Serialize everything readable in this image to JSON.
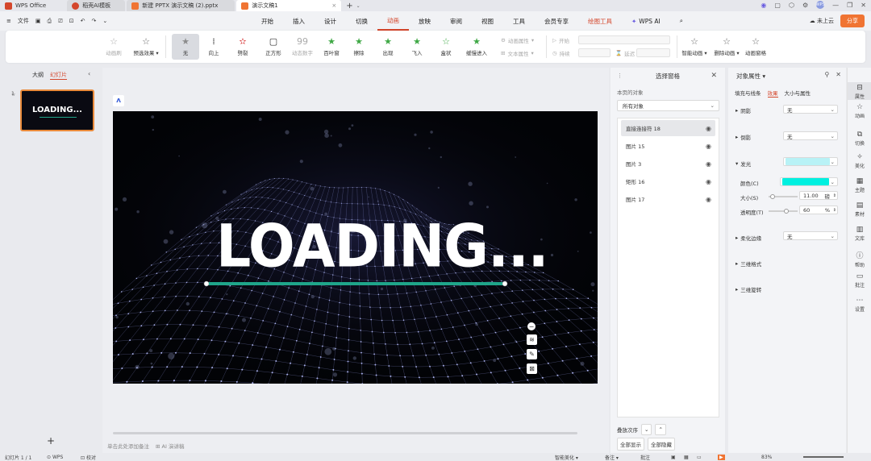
{
  "titlebar": {
    "tabs": [
      {
        "label": "WPS Office",
        "color": "#d4462b"
      },
      {
        "label": "稻壳AI模板",
        "color": "#d4462b"
      },
      {
        "label": "新建 PPTX 演示文稿 (2).pptx",
        "color": "#f07433"
      },
      {
        "label": "演示文稿1",
        "color": "#f07433"
      }
    ],
    "add": "+",
    "avatar_text": "WPS"
  },
  "menubar": {
    "file_label": "文件",
    "tabs": [
      "开始",
      "插入",
      "设计",
      "切换",
      "动画",
      "放映",
      "审阅",
      "视图",
      "工具",
      "会员专享",
      "绘图工具",
      "WPS AI"
    ],
    "active_tab": "动画",
    "cloud_label": "未上云",
    "share_label": "分享"
  },
  "ribbon": {
    "animation_pane": "动画刷",
    "preset_effects": "预选效果",
    "effects": [
      "无",
      "向上",
      "劈裂",
      "正方形",
      "动态数字",
      "百叶窗",
      "擦除",
      "出现",
      "飞入",
      "盒状",
      "缓慢进入"
    ],
    "anim_props": "动画属性",
    "text_props": "文本属性",
    "start_label": "开始",
    "duration_label": "持续",
    "delay_label": "延迟",
    "smart_anim": "智能动画",
    "delete_anim": "删除动画",
    "anim_window": "动画窗格"
  },
  "left_panel": {
    "tabs": [
      "大纲",
      "幻灯片"
    ],
    "active_tab": "幻灯片",
    "slide_number": "1",
    "thumb_text": "LOADING..."
  },
  "slide": {
    "title_text": "LOADING...",
    "progress_color": "#1fa58a",
    "progress_fill": 1.0
  },
  "canvas": {
    "notes_placeholder": "单击此处添加备注",
    "ai_notes": "AI 演讲稿"
  },
  "selection_pane": {
    "title": "选择窗格",
    "subtitle": "本页的对象",
    "filter": "所有对象",
    "items": [
      "直接连接符 18",
      "图片 15",
      "图片 3",
      "矩形 16",
      "图片 17"
    ],
    "order_label": "叠放次序",
    "show_all": "全部显示",
    "hide_all": "全部隐藏"
  },
  "properties_pane": {
    "title": "对象属性",
    "tabs": [
      "填充与线条",
      "效果",
      "大小与属性"
    ],
    "active_tab": "效果",
    "shadow": {
      "label": "阴影",
      "value": "无"
    },
    "reflection": {
      "label": "倒影",
      "value": "无"
    },
    "glow": {
      "label": "发光",
      "color_label": "颜色(C)",
      "color": "#00f0e0",
      "preset_color": "#b8f2f6",
      "size_label": "大小(S)",
      "size_value": "11.00",
      "size_unit": "磅",
      "transparency_label": "透明度(T)",
      "transparency_value": "60",
      "transparency_unit": "%"
    },
    "soft_edges": {
      "label": "柔化边缘",
      "value": "无"
    },
    "format_3d": "三维格式",
    "rotation_3d": "三维旋转"
  },
  "right_strip": [
    "属性",
    "动画",
    "切换",
    "美化",
    "主题",
    "素材",
    "文库",
    "帮助",
    "批注",
    "设置"
  ],
  "statusbar": {
    "slide_count": "幻灯片 1 / 1",
    "theme": "WPS",
    "proof": "校对",
    "smart_beautify": "智能美化",
    "notes": "备注",
    "comments": "批注",
    "zoom": "83%"
  }
}
